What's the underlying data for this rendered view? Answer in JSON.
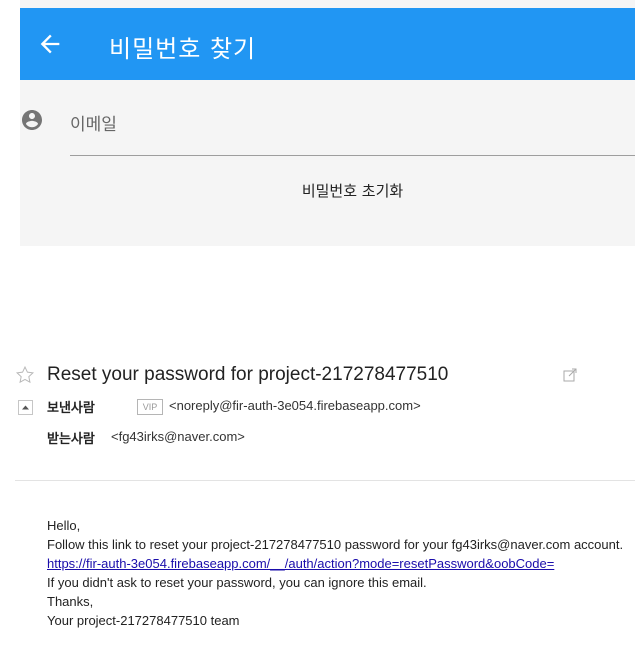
{
  "app": {
    "title": "비밀번호 찾기",
    "email_placeholder": "이메일",
    "reset_button_label": "비밀번호 초기화",
    "appbar_color": "#2196f3"
  },
  "email": {
    "subject": "Reset your password for project-217278477510",
    "sender_label": "보낸사람",
    "sender_badge": "VIP",
    "sender_address": "<noreply@fir-auth-3e054.firebaseapp.com>",
    "recipient_label": "받는사람",
    "recipient_address": "<fg43irks@naver.com>",
    "body": {
      "greeting": "Hello,",
      "line1": "Follow this link to reset your project-217278477510 password for your fg43irks@naver.com account.",
      "link": "https://fir-auth-3e054.firebaseapp.com/__/auth/action?mode=resetPassword&oobCode=",
      "line3": "If you didn't ask to reset your password, you can ignore this email.",
      "thanks": "Thanks,",
      "signature": "Your project-217278477510 team"
    }
  }
}
